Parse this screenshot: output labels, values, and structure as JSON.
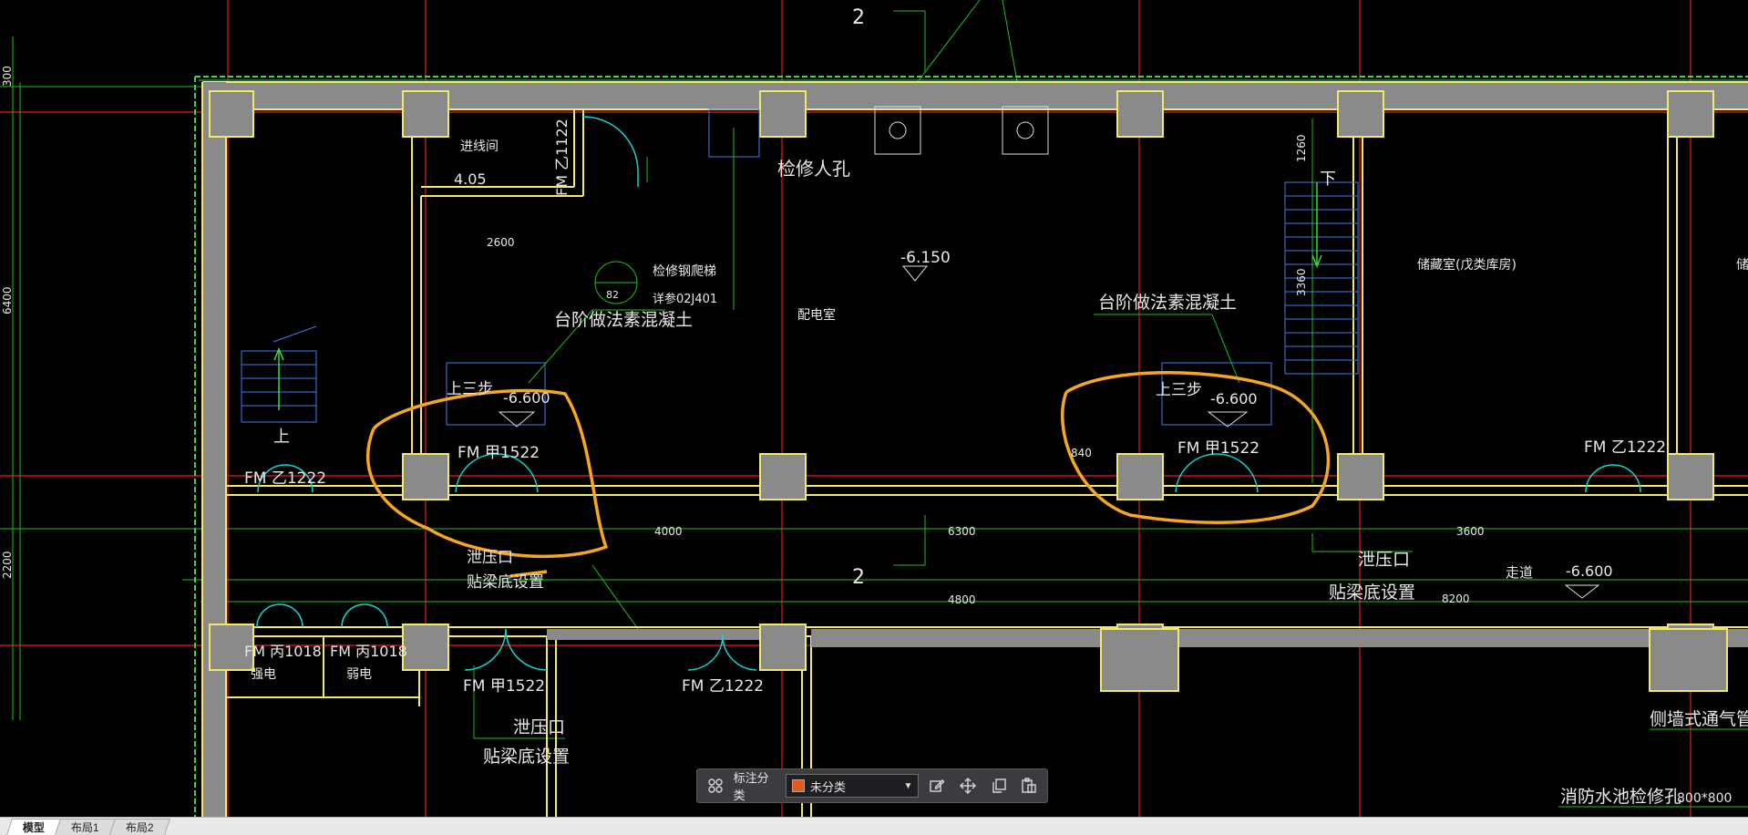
{
  "layout_tabs": [
    "模型",
    "布局1",
    "布局2"
  ],
  "active_tab": "模型",
  "annotation_toolbar": {
    "label": "标注分类",
    "select_value": "未分类",
    "select_color": "#e2591d",
    "icons": [
      "grid-icon",
      "edit-icon",
      "move-icon",
      "copy-icon",
      "paste-icon"
    ]
  },
  "drawing": {
    "labels": {
      "stair_top": "2",
      "mid_2": "2",
      "maint_hole": "检修人孔",
      "cable_room": "进线间",
      "cable_room_level": "4.05",
      "door_fm_z1122": "FM 乙1122",
      "ladder": "检修钢爬梯",
      "ladder_ref": "详参02J401",
      "circle_num": "82",
      "step_note_left": "台阶做法素混凝土",
      "step_note_right": "台阶做法素混凝土",
      "power_room": "配电室",
      "level_6150": "-6.150",
      "storage": "储藏室(戊类库房)",
      "storage_right": "储",
      "up_stairs_left": "上三步",
      "up_stairs_right": "上三步",
      "level_6600_left": "-6.600",
      "level_6600_right": "-6.600",
      "level_6600_corridor": "-6.600",
      "door_fm_jia1522_a": "FM 甲1522",
      "door_fm_jia1522_b": "FM 甲1522",
      "door_fm_jia1522_c": "FM 甲1522",
      "door_fm_z1222_a": "FM 乙1222",
      "door_fm_z1222_b": "FM 乙1222",
      "door_fm_z1222_c": "FM 乙1222",
      "door_fm_bing1018_a": "FM 丙1018",
      "door_fm_bing1018_b": "FM 丙1018",
      "strong_elec": "强电",
      "weak_elec": "弱电",
      "up_left": "上",
      "down_right": "下",
      "pressure_port_a": "泄压口",
      "pressure_port_b": "泄压口",
      "pressure_port_c": "泄压口",
      "beam_bottom_a": "贴梁底设置",
      "beam_bottom_b": "贴梁底设置",
      "beam_bottom_c": "贴梁底设置",
      "corridor": "走道",
      "side_vent": "侧墙式通气管",
      "pool_hatch": "消防水池检修孔",
      "pool_hatch_size": "800*800",
      "size_8200": "8200",
      "size_840": "840",
      "size_4800": "4800",
      "size_6300": "6300",
      "size_4000": "4000",
      "size_3600": "3600",
      "size_2600": "2600",
      "size_1260": "1260",
      "size_3360": "3360",
      "left_6400": "6400",
      "left_300": "300",
      "left_2200": "2200"
    }
  }
}
